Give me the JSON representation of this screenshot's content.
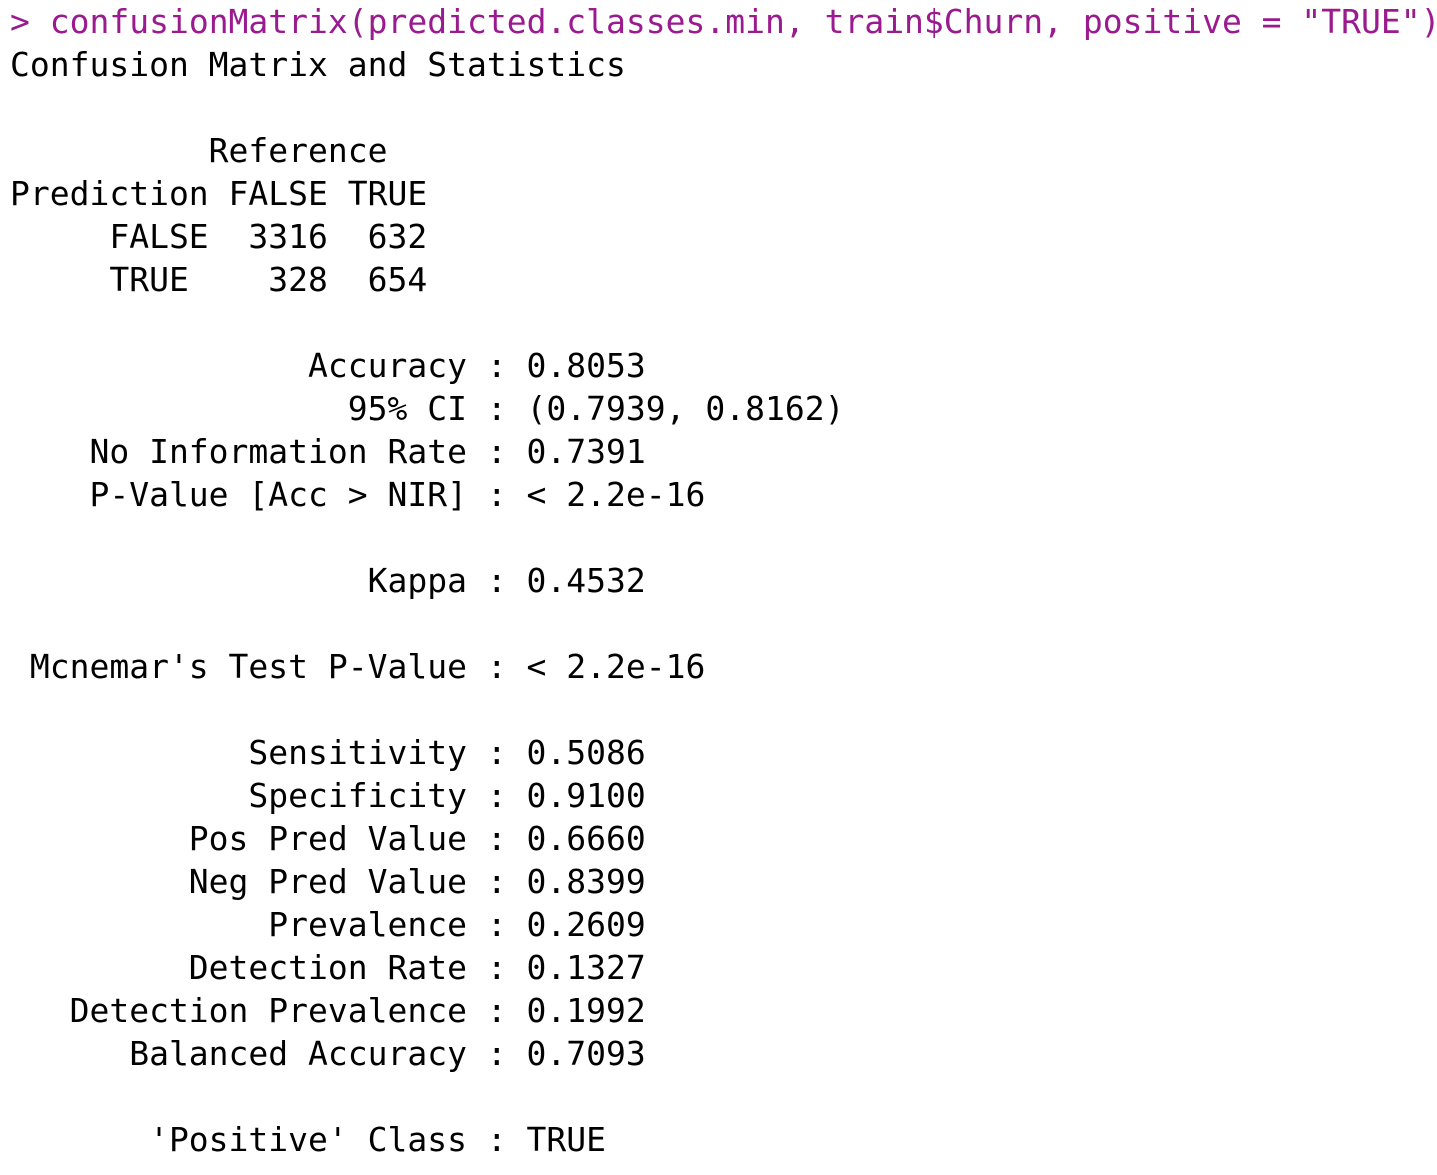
{
  "console": {
    "prompt": "> ",
    "command": "confusionMatrix(predicted.classes.min, train$Churn, positive = \"TRUE\")",
    "output_lines": [
      "Confusion Matrix and Statistics",
      "",
      "          Reference",
      "Prediction FALSE TRUE",
      "     FALSE  3316  632",
      "     TRUE    328  654",
      "",
      "               Accuracy : 0.8053",
      "                 95% CI : (0.7939, 0.8162)",
      "    No Information Rate : 0.7391",
      "    P-Value [Acc > NIR] : < 2.2e-16",
      "",
      "                  Kappa : 0.4532",
      "",
      " Mcnemar's Test P-Value : < 2.2e-16",
      "",
      "            Sensitivity : 0.5086",
      "            Specificity : 0.9100",
      "         Pos Pred Value : 0.6660",
      "         Neg Pred Value : 0.8399",
      "             Prevalence : 0.2609",
      "         Detection Rate : 0.1327",
      "   Detection Prevalence : 0.1992",
      "      Balanced Accuracy : 0.7093",
      "",
      "       'Positive' Class : TRUE"
    ]
  },
  "colors": {
    "command": "#9a1a8f",
    "output": "#000000",
    "background": "#ffffff"
  }
}
